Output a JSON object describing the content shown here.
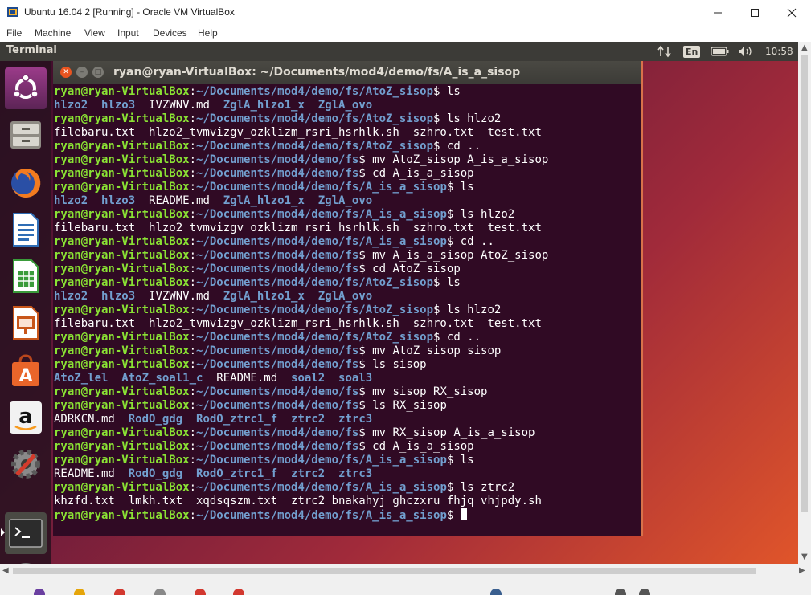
{
  "window": {
    "title": "Ubuntu 16.04 2 [Running] - Oracle VM VirtualBox"
  },
  "menu": [
    "File",
    "Machine",
    "View",
    "Input",
    "Devices",
    "Help"
  ],
  "topbar": {
    "app_name": "Terminal",
    "language": "En",
    "time": "10:58"
  },
  "launcher": {
    "items": [
      {
        "name": "ubuntu-dash-icon"
      },
      {
        "name": "files-icon"
      },
      {
        "name": "firefox-icon"
      },
      {
        "name": "writer-icon"
      },
      {
        "name": "calc-icon"
      },
      {
        "name": "impress-icon"
      },
      {
        "name": "software-center-icon"
      },
      {
        "name": "amazon-icon"
      },
      {
        "name": "system-settings-icon"
      },
      {
        "name": "terminal-icon"
      },
      {
        "name": "software-updater-icon"
      }
    ]
  },
  "terminal": {
    "title": "ryan@ryan-VirtualBox: ~/Documents/mod4/demo/fs/A_is_a_sisop",
    "prompt_user": "ryan@ryan-VirtualBox",
    "lines": [
      {
        "type": "prompt",
        "path": "~/Documents/mod4/demo/fs/AtoZ_sisop",
        "cmd": "ls"
      },
      {
        "type": "out",
        "items": [
          {
            "t": "hlzo2",
            "c": "d"
          },
          {
            "t": "  "
          },
          {
            "t": "hlzo3",
            "c": "d"
          },
          {
            "t": "  IVZWNV.md  "
          },
          {
            "t": "ZglA_hlzo1_x",
            "c": "d"
          },
          {
            "t": "  "
          },
          {
            "t": "ZglA_ovo",
            "c": "d"
          }
        ]
      },
      {
        "type": "prompt",
        "path": "~/Documents/mod4/demo/fs/AtoZ_sisop",
        "cmd": "ls hlzo2"
      },
      {
        "type": "out",
        "items": [
          {
            "t": "filebaru.txt  hlzo2_tvmvizgv_ozklizm_rsri_hsrhlk.sh  szhro.txt  test.txt"
          }
        ]
      },
      {
        "type": "prompt",
        "path": "~/Documents/mod4/demo/fs/AtoZ_sisop",
        "cmd": "cd .."
      },
      {
        "type": "prompt",
        "path": "~/Documents/mod4/demo/fs",
        "cmd": "mv AtoZ_sisop A_is_a_sisop"
      },
      {
        "type": "prompt",
        "path": "~/Documents/mod4/demo/fs",
        "cmd": "cd A_is_a_sisop"
      },
      {
        "type": "prompt",
        "path": "~/Documents/mod4/demo/fs/A_is_a_sisop",
        "cmd": "ls"
      },
      {
        "type": "out",
        "items": [
          {
            "t": "hlzo2",
            "c": "d"
          },
          {
            "t": "  "
          },
          {
            "t": "hlzo3",
            "c": "d"
          },
          {
            "t": "  README.md  "
          },
          {
            "t": "ZglA_hlzo1_x",
            "c": "d"
          },
          {
            "t": "  "
          },
          {
            "t": "ZglA_ovo",
            "c": "d"
          }
        ]
      },
      {
        "type": "prompt",
        "path": "~/Documents/mod4/demo/fs/A_is_a_sisop",
        "cmd": "ls hlzo2"
      },
      {
        "type": "out",
        "items": [
          {
            "t": "filebaru.txt  hlzo2_tvmvizgv_ozklizm_rsri_hsrhlk.sh  szhro.txt  test.txt"
          }
        ]
      },
      {
        "type": "prompt",
        "path": "~/Documents/mod4/demo/fs/A_is_a_sisop",
        "cmd": "cd .."
      },
      {
        "type": "prompt",
        "path": "~/Documents/mod4/demo/fs",
        "cmd": "mv A_is_a_sisop AtoZ_sisop"
      },
      {
        "type": "prompt",
        "path": "~/Documents/mod4/demo/fs",
        "cmd": "cd AtoZ_sisop"
      },
      {
        "type": "prompt",
        "path": "~/Documents/mod4/demo/fs/AtoZ_sisop",
        "cmd": "ls"
      },
      {
        "type": "out",
        "items": [
          {
            "t": "hlzo2",
            "c": "d"
          },
          {
            "t": "  "
          },
          {
            "t": "hlzo3",
            "c": "d"
          },
          {
            "t": "  IVZWNV.md  "
          },
          {
            "t": "ZglA_hlzo1_x",
            "c": "d"
          },
          {
            "t": "  "
          },
          {
            "t": "ZglA_ovo",
            "c": "d"
          }
        ]
      },
      {
        "type": "prompt",
        "path": "~/Documents/mod4/demo/fs/AtoZ_sisop",
        "cmd": "ls hlzo2"
      },
      {
        "type": "out",
        "items": [
          {
            "t": "filebaru.txt  hlzo2_tvmvizgv_ozklizm_rsri_hsrhlk.sh  szhro.txt  test.txt"
          }
        ]
      },
      {
        "type": "prompt",
        "path": "~/Documents/mod4/demo/fs/AtoZ_sisop",
        "cmd": "cd .."
      },
      {
        "type": "prompt",
        "path": "~/Documents/mod4/demo/fs",
        "cmd": "mv AtoZ_sisop sisop"
      },
      {
        "type": "prompt",
        "path": "~/Documents/mod4/demo/fs",
        "cmd": "ls sisop"
      },
      {
        "type": "out",
        "items": [
          {
            "t": "AtoZ_lel",
            "c": "d"
          },
          {
            "t": "  "
          },
          {
            "t": "AtoZ_soal1_c",
            "c": "d"
          },
          {
            "t": "  README.md  "
          },
          {
            "t": "soal2",
            "c": "d"
          },
          {
            "t": "  "
          },
          {
            "t": "soal3",
            "c": "d"
          }
        ]
      },
      {
        "type": "prompt",
        "path": "~/Documents/mod4/demo/fs",
        "cmd": "mv sisop RX_sisop"
      },
      {
        "type": "prompt",
        "path": "~/Documents/mod4/demo/fs",
        "cmd": "ls RX_sisop"
      },
      {
        "type": "out",
        "items": [
          {
            "t": "ADRKCN.md  "
          },
          {
            "t": "RodO_gdg",
            "c": "d"
          },
          {
            "t": "  "
          },
          {
            "t": "RodO_ztrc1_f",
            "c": "d"
          },
          {
            "t": "  "
          },
          {
            "t": "ztrc2",
            "c": "d"
          },
          {
            "t": "  "
          },
          {
            "t": "ztrc3",
            "c": "d"
          }
        ]
      },
      {
        "type": "prompt",
        "path": "~/Documents/mod4/demo/fs",
        "cmd": "mv RX_sisop A_is_a_sisop"
      },
      {
        "type": "prompt",
        "path": "~/Documents/mod4/demo/fs",
        "cmd": "cd A_is_a_sisop"
      },
      {
        "type": "prompt",
        "path": "~/Documents/mod4/demo/fs/A_is_a_sisop",
        "cmd": "ls"
      },
      {
        "type": "out",
        "items": [
          {
            "t": "README.md  "
          },
          {
            "t": "RodO_gdg",
            "c": "d"
          },
          {
            "t": "  "
          },
          {
            "t": "RodO_ztrc1_f",
            "c": "d"
          },
          {
            "t": "  "
          },
          {
            "t": "ztrc2",
            "c": "d"
          },
          {
            "t": "  "
          },
          {
            "t": "ztrc3",
            "c": "d"
          }
        ]
      },
      {
        "type": "prompt",
        "path": "~/Documents/mod4/demo/fs/A_is_a_sisop",
        "cmd": "ls ztrc2"
      },
      {
        "type": "out",
        "items": [
          {
            "t": "khzfd.txt  lmkh.txt  xqdsqszm.txt  ztrc2_bnakahyj_ghczxru_fhjq_vhjpdy.sh"
          }
        ]
      },
      {
        "type": "prompt",
        "path": "~/Documents/mod4/demo/fs/A_is_a_sisop",
        "cmd": "",
        "cursor": true
      }
    ]
  },
  "colors": {
    "terminal_bg": "#300a24",
    "prompt_user": "#8ae234",
    "prompt_path": "#729fcf",
    "dir": "#729fcf"
  }
}
